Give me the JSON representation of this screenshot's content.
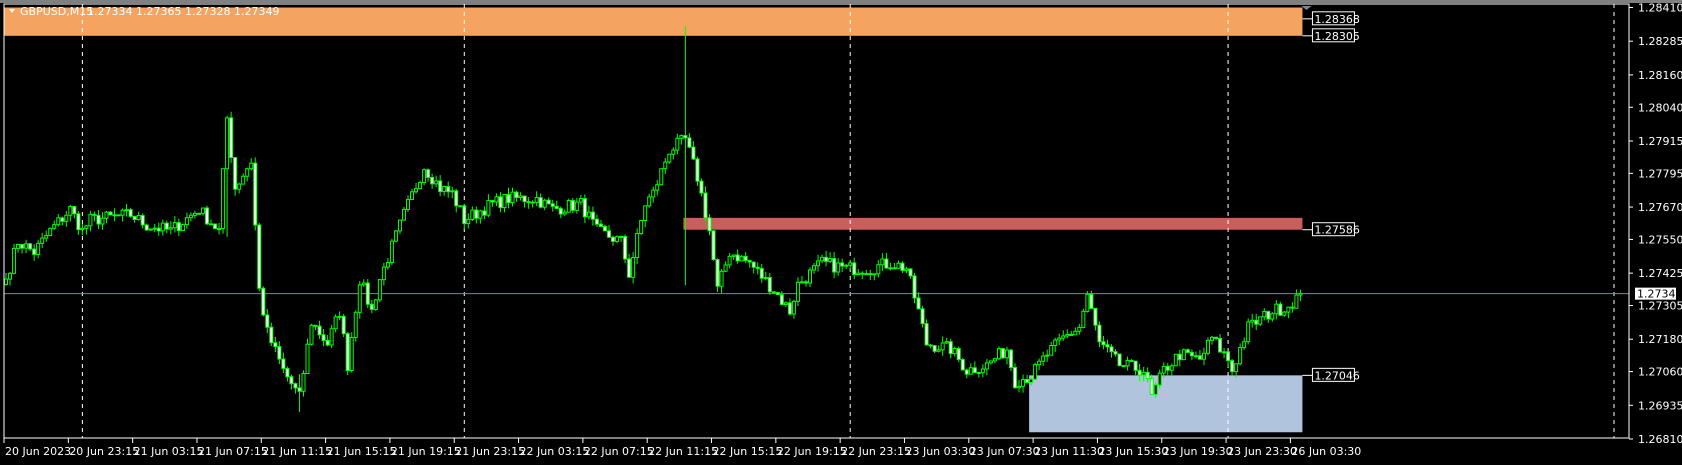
{
  "header": {
    "symbol": "GBPUSD,M15",
    "ohlc": "1.27334 1.27365 1.27328 1.27349",
    "collapse_icon": "triangle-down-icon"
  },
  "colors": {
    "background": "#000000",
    "candle": "#00ff00",
    "bull_body": "#000000",
    "bear_body": "#ffffff",
    "supply_zone_top": "#f4a460",
    "supply_zone_mid": "#cd5c5c",
    "demand_zone": "#b0c4de",
    "price_line": "#778899",
    "grid": "#ffffff"
  },
  "chart_data": {
    "type": "candlestick",
    "title": "GBPUSD,M15",
    "timeframe_minutes": 15,
    "ylim": [
      1.2681,
      1.2841
    ],
    "y_ticks": [
      "1.28410",
      "1.28285",
      "1.28160",
      "1.28040",
      "1.27915",
      "1.27795",
      "1.27670",
      "1.27550",
      "1.27425",
      "1.27305",
      "1.27180",
      "1.27060",
      "1.26935",
      "1.26810"
    ],
    "x_ticks": [
      "20 Jun 2023",
      "20 Jun 23:15",
      "21 Jun 03:15",
      "21 Jun 07:15",
      "21 Jun 11:15",
      "21 Jun 15:15",
      "21 Jun 19:15",
      "21 Jun 23:15",
      "22 Jun 03:15",
      "22 Jun 07:15",
      "22 Jun 11:15",
      "22 Jun 15:15",
      "22 Jun 19:15",
      "22 Jun 23:15",
      "23 Jun 03:30",
      "23 Jun 07:30",
      "23 Jun 11:30",
      "23 Jun 15:30",
      "23 Jun 19:30",
      "23 Jun 23:30",
      "26 Jun 03:30"
    ],
    "x_tick_every_bars": 16,
    "grid_bars": [
      19,
      114,
      210,
      304,
      400
    ],
    "current_price": "1.27349",
    "close_path": [
      [
        0,
        1.27403
      ],
      [
        3,
        1.27542
      ],
      [
        7,
        1.27503
      ],
      [
        11,
        1.27582
      ],
      [
        16,
        1.27662
      ],
      [
        19,
        1.27582
      ],
      [
        21,
        1.27622
      ],
      [
        31,
        1.27642
      ],
      [
        35,
        1.27602
      ],
      [
        41,
        1.27582
      ],
      [
        48,
        1.27662
      ],
      [
        53,
        1.27582
      ],
      [
        55,
        1.28
      ],
      [
        57,
        1.27741
      ],
      [
        61,
        1.27841
      ],
      [
        63,
        1.27363
      ],
      [
        65,
        1.27204
      ],
      [
        69,
        1.27065
      ],
      [
        73,
        1.26965
      ],
      [
        76,
        1.27244
      ],
      [
        80,
        1.27164
      ],
      [
        83,
        1.27284
      ],
      [
        85,
        1.27085
      ],
      [
        88,
        1.27403
      ],
      [
        91,
        1.27284
      ],
      [
        93,
        1.27403
      ],
      [
        99,
        1.27642
      ],
      [
        104,
        1.27821
      ],
      [
        108,
        1.27741
      ],
      [
        111,
        1.27721
      ],
      [
        114,
        1.27622
      ],
      [
        121,
        1.27682
      ],
      [
        125,
        1.27702
      ],
      [
        132,
        1.27702
      ],
      [
        136,
        1.27662
      ],
      [
        143,
        1.27682
      ],
      [
        147,
        1.27582
      ],
      [
        153,
        1.27542
      ],
      [
        155,
        1.27423
      ],
      [
        159,
        1.27682
      ],
      [
        161,
        1.27721
      ],
      [
        165,
        1.27881
      ],
      [
        169,
        1.2792
      ],
      [
        172,
        1.27781
      ],
      [
        175,
        1.27582
      ],
      [
        177,
        1.27363
      ],
      [
        180,
        1.27503
      ],
      [
        185,
        1.27463
      ],
      [
        191,
        1.27363
      ],
      [
        195,
        1.27284
      ],
      [
        197,
        1.27383
      ],
      [
        203,
        1.27463
      ],
      [
        209,
        1.27443
      ],
      [
        215,
        1.27443
      ],
      [
        220,
        1.27463
      ],
      [
        224,
        1.27443
      ],
      [
        227,
        1.27284
      ],
      [
        229,
        1.27164
      ],
      [
        235,
        1.27144
      ],
      [
        239,
        1.27065
      ],
      [
        244,
        1.27085
      ],
      [
        249,
        1.27144
      ],
      [
        251,
        1.27025
      ],
      [
        255,
        1.27045
      ],
      [
        259,
        1.27124
      ],
      [
        263,
        1.27184
      ],
      [
        267,
        1.27224
      ],
      [
        269,
        1.27343
      ],
      [
        272,
        1.27164
      ],
      [
        277,
        1.27085
      ],
      [
        283,
        1.27065
      ],
      [
        285,
        1.26965
      ],
      [
        288,
        1.27065
      ],
      [
        292,
        1.27124
      ],
      [
        297,
        1.27104
      ],
      [
        300,
        1.27184
      ],
      [
        304,
        1.27104
      ],
      [
        305,
        1.27065
      ],
      [
        309,
        1.27224
      ],
      [
        315,
        1.27284
      ],
      [
        319,
        1.27304
      ],
      [
        322,
        1.27349
      ]
    ],
    "spikes": [
      [
        169,
        1.2834,
        1.2738
      ],
      [
        55,
        1.28,
        1.2756
      ],
      [
        73,
        1.2705,
        1.2691
      ]
    ],
    "zones": [
      {
        "name": "upper-supply-zone",
        "top": 1.2841,
        "bottom": 1.28305,
        "from_bar": 0,
        "to_bar": 322,
        "color": "#f4a460",
        "labels": [
          "1.28368",
          "1.28305"
        ]
      },
      {
        "name": "mid-supply-zone",
        "top": 1.2763,
        "bottom": 1.27586,
        "from_bar": 169,
        "to_bar": 322,
        "color": "#cd5c5c",
        "labels": [
          "1.27586"
        ]
      },
      {
        "name": "demand-zone",
        "top": 1.27046,
        "bottom": 1.26835,
        "from_bar": 255,
        "to_bar": 322,
        "color": "#b0c4de",
        "labels": [
          "1.27046"
        ]
      }
    ],
    "zone_label_prices": [
      1.28368,
      1.28305,
      1.27586,
      1.27046
    ]
  }
}
